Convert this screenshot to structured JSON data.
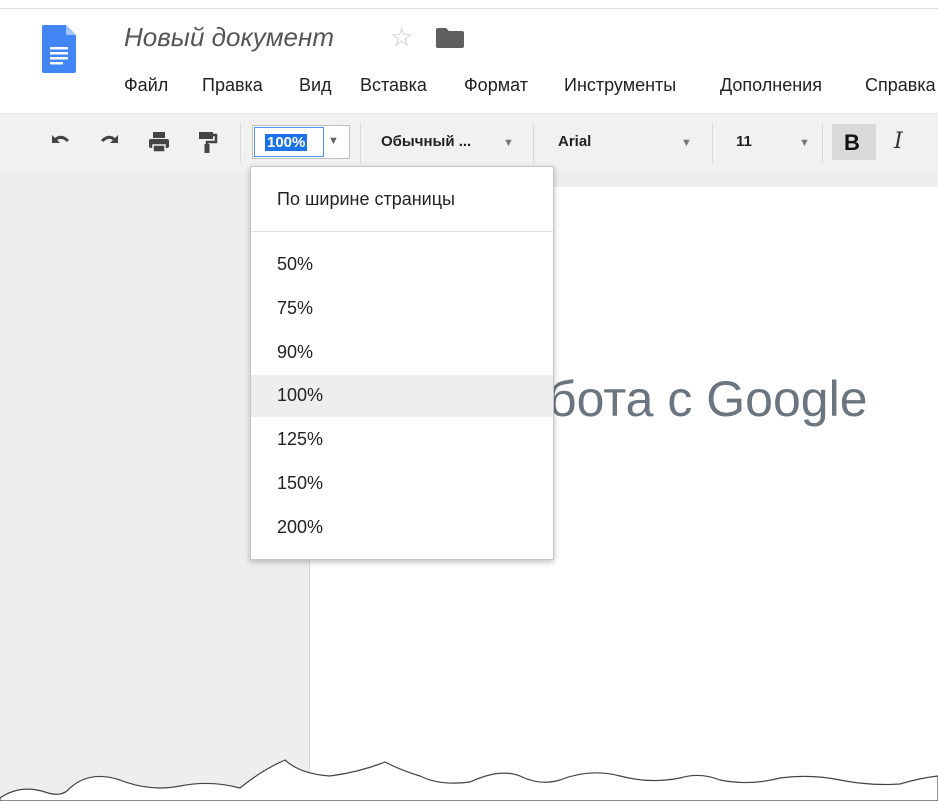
{
  "document": {
    "title": "Новый документ",
    "page_text": "бота с Google"
  },
  "menu": {
    "items": [
      "Файл",
      "Правка",
      "Вид",
      "Вставка",
      "Формат",
      "Инструменты",
      "Дополнения",
      "Справка"
    ]
  },
  "toolbar": {
    "zoom_value": "100%",
    "style_value": "Обычный ...",
    "font_value": "Arial",
    "font_size_value": "11",
    "bold_label": "B",
    "italic_label": "I"
  },
  "zoom_dropdown": {
    "fit_label": "По ширине страницы",
    "options": [
      "50%",
      "75%",
      "90%",
      "100%",
      "125%",
      "150%",
      "200%"
    ],
    "selected": "100%"
  },
  "colors": {
    "accent": "#4285f4",
    "selection": "#1a73e8",
    "toolbar_bg": "#f1f1f1",
    "canvas_bg": "#eeeeee"
  },
  "icons": {
    "doc": "docs-file-icon",
    "star": "star-outline-icon",
    "folder": "folder-icon",
    "undo": "undo-icon",
    "redo": "redo-icon",
    "print": "print-icon",
    "paint_format": "paint-format-icon"
  }
}
